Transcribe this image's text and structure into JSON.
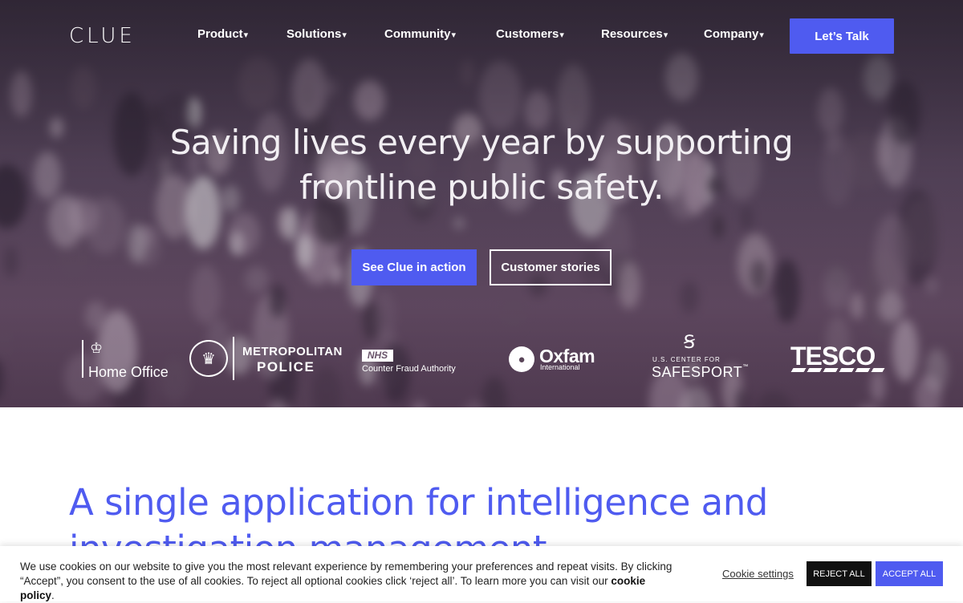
{
  "nav": {
    "logo": "CLUE",
    "items": [
      {
        "label": "Product",
        "caret": "▾"
      },
      {
        "label": "Solutions",
        "caret": "▾"
      },
      {
        "label": "Community",
        "caret": "▾"
      },
      {
        "label": "Customers",
        "caret": "▾"
      },
      {
        "label": "Resources",
        "caret": "▾"
      },
      {
        "label": "Company",
        "caret": "▾"
      }
    ],
    "cta": "Let’s Talk"
  },
  "hero": {
    "headline_line1": "Saving lives every year by supporting",
    "headline_line2": "frontline public safety.",
    "primary_button": "See Clue in action",
    "secondary_button": "Customer stories"
  },
  "logos": {
    "home_office": "Home Office",
    "met_line1": "METROPOLITAN",
    "met_line2": "POLICE",
    "nhs_badge": "NHS",
    "nhs_text": "Counter Fraud Authority",
    "oxfam_name": "Oxfam",
    "oxfam_sub": "International",
    "safesport_line1": "U.S. CENTER FOR",
    "safesport_line2": "SAFESPORT",
    "safesport_tm": "™",
    "tesco": "TESCO"
  },
  "section": {
    "title": "A single application for intelligence and investigation management"
  },
  "cookie": {
    "text_before": "We use cookies on our website to give you the most relevant experience by remembering your preferences and repeat visits. By clicking “Accept”, you consent to the use of all cookies. To reject all optional cookies click ‘reject all’. To learn more you can visit our ",
    "policy_link": "cookie policy",
    "text_after": ".",
    "settings": "Cookie settings",
    "reject": "REJECT ALL",
    "accept": "ACCEPT ALL"
  },
  "colors": {
    "accent": "#4f5bf0",
    "hero_tint": "#5e4c63",
    "reject_bg": "#111111"
  }
}
